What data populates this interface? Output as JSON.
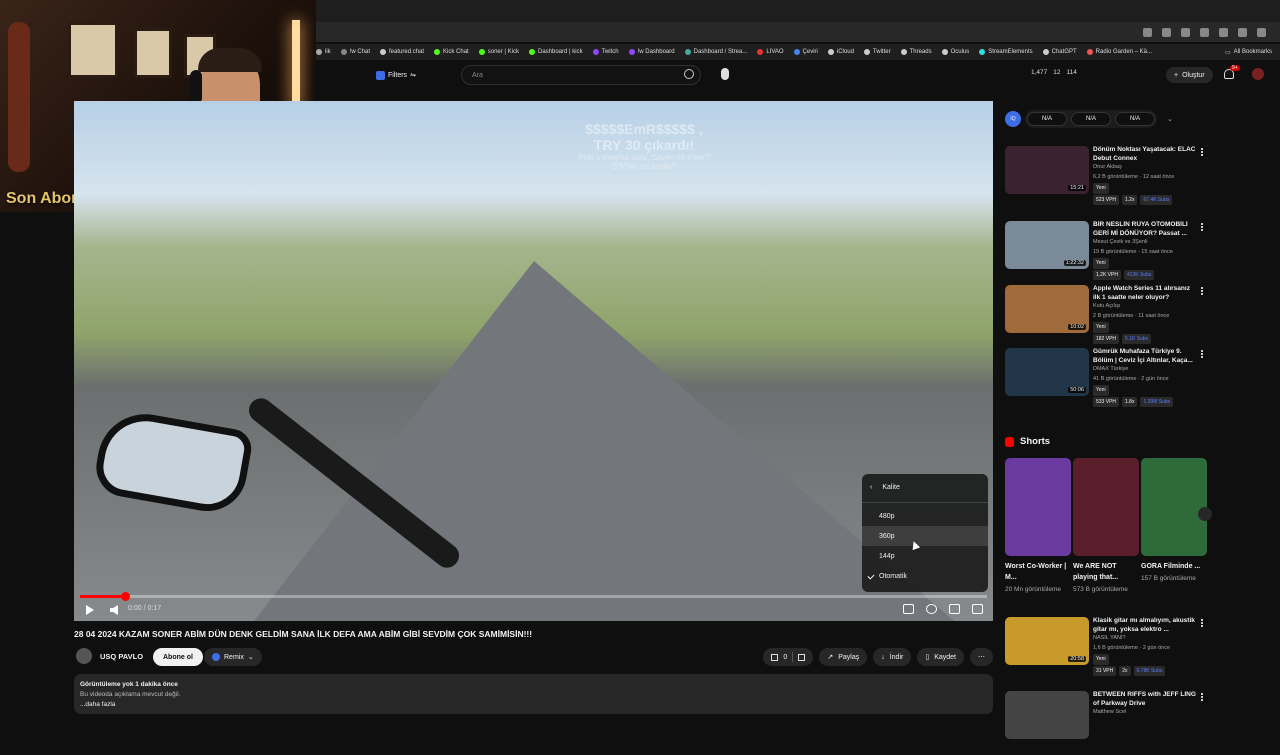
{
  "webcam": {
    "sub_label": "Son Abone: drvays"
  },
  "bookmarks": [
    "lik",
    "!w Chat",
    "featured.chat",
    "Kick Chat",
    "soner | Kick",
    "Dashboard | kick",
    "Twitch",
    "!w Dashboard",
    "Dashboard / Strea...",
    "LIVAO",
    "Çeviri",
    "iCloud",
    "Twitter",
    "Threads",
    "Oculus",
    "StreamElements",
    "ChatGPT",
    "Radio Garden – Kä..."
  ],
  "all_bookmarks": "All Bookmarks",
  "header": {
    "filters_label": "Filters",
    "search_placeholder": "Ara",
    "stats": [
      "1,477",
      "12",
      "114"
    ],
    "create_label": "Oluştur",
    "notif_count": "9+"
  },
  "video": {
    "overlay_line1": "$$$$$EmR$$$$$ ,",
    "overlay_line2": "TRY 30 çıkardı!",
    "overlay_line3": "Peki o meşhur soru :Seven mi s*ker?",
    "overlay_line4": "S*k*len mi sevilir?",
    "time": "0:00 / 0:17",
    "progress": 0.05
  },
  "quality_menu": {
    "title": "Kalite",
    "options": [
      "480p",
      "360p",
      "144p",
      "Otomatik"
    ],
    "selected": "Otomatik",
    "hovered": "360p"
  },
  "title": "28 04 2024 KAZAM SONER ABİM DÜN DENK GELDİM SANA İLK DEFA AMA ABİM GİBİ SEVDİM ÇOK SAMİMİSİN!!!",
  "channel": {
    "name": "USQ PAVLO",
    "subscribe": "Abone ol",
    "remix": "Remix"
  },
  "actions": {
    "likes": "0",
    "share": "Paylaş",
    "download": "İndir",
    "save": "Kaydet"
  },
  "description": {
    "meta": "Görüntüleme yok  1 dakika önce",
    "text": "Bu videoda açıklama mevcut değil.",
    "more": "...daha fazla"
  },
  "sidebar": {
    "chip_logo": "IQ",
    "chips": [
      "N/A",
      "N/A",
      "N/A"
    ],
    "recommendations": [
      {
        "title": "Dönüm Noktası Yaşatacak: ELAC Debut Connex",
        "channel": "Onur Akbaş",
        "meta": "6,2 B görüntüleme · 12 saat önce",
        "badge": "Yeni",
        "tags": [
          "523 VPH",
          "1.2x",
          "67.4K Subs"
        ],
        "duration": "15:21",
        "color": "#3a2230"
      },
      {
        "title": "BİR NESLİN RÜYA OTOMOBİLİ GERİ Mİ DÖNÜYOR? Passat ...",
        "channel": "Mesut Çevik ve 3Şenli",
        "meta": "19 B görüntüleme · 15 saat önce",
        "badge": "Yeni",
        "tags": [
          "1.2K VPH",
          "413K Subs"
        ],
        "duration": "1:22:32",
        "color": "#7b8a98"
      },
      {
        "title": "Apple Watch Series 11 alırsanız ilk 1 saatte neler oluyor?",
        "channel": "Kutu Açılışı",
        "meta": "2 B görüntüleme · 11 saat önce",
        "badge": "Yeni",
        "tags": [
          "182 VPH",
          "5.1K Subs"
        ],
        "duration": "10:02",
        "color": "#a16a3a"
      },
      {
        "title": "Gümrük Muhafaza Türkiye 9. Bölüm | Ceviz İçi Altınlar, Kaça...",
        "channel": "DMAX Türkiye",
        "meta": "41 B görüntüleme · 2 gün önce",
        "badge": "Yeni",
        "tags": [
          "533 VPH",
          "1.8x",
          "1.29M Subs"
        ],
        "duration": "50:06",
        "color": "#22364a"
      }
    ],
    "shorts_title": "Shorts",
    "shorts": [
      {
        "title": "Worst Co-Worker | M...",
        "views": "20 Mn görüntüleme",
        "color": "#6a3aa0"
      },
      {
        "title": "We ARE NOT playing that...",
        "views": "573 B görüntüleme",
        "color": "#5a1f2a"
      },
      {
        "title": "GORA Filminde ...",
        "views": "157 B görüntüleme",
        "color": "#2f6a3a"
      }
    ],
    "more": [
      {
        "title": "Klasik gitar mı almalıyım, akustik gitar mı, yoksa elektro ...",
        "channel": "NASIL YANİ?",
        "meta": "1,6 B görüntüleme · 2 gün önce",
        "badge": "Yeni",
        "tags": [
          "31 VPH",
          "2x",
          "6.78K Subs"
        ],
        "duration": "20:58",
        "color": "#c89a2a"
      },
      {
        "title": "BETWEEN RIFFS with JEFF LING of Parkway Drive",
        "channel": "Matthew Scel",
        "meta": "",
        "badge": "",
        "tags": [],
        "duration": "",
        "color": "#444"
      }
    ]
  }
}
